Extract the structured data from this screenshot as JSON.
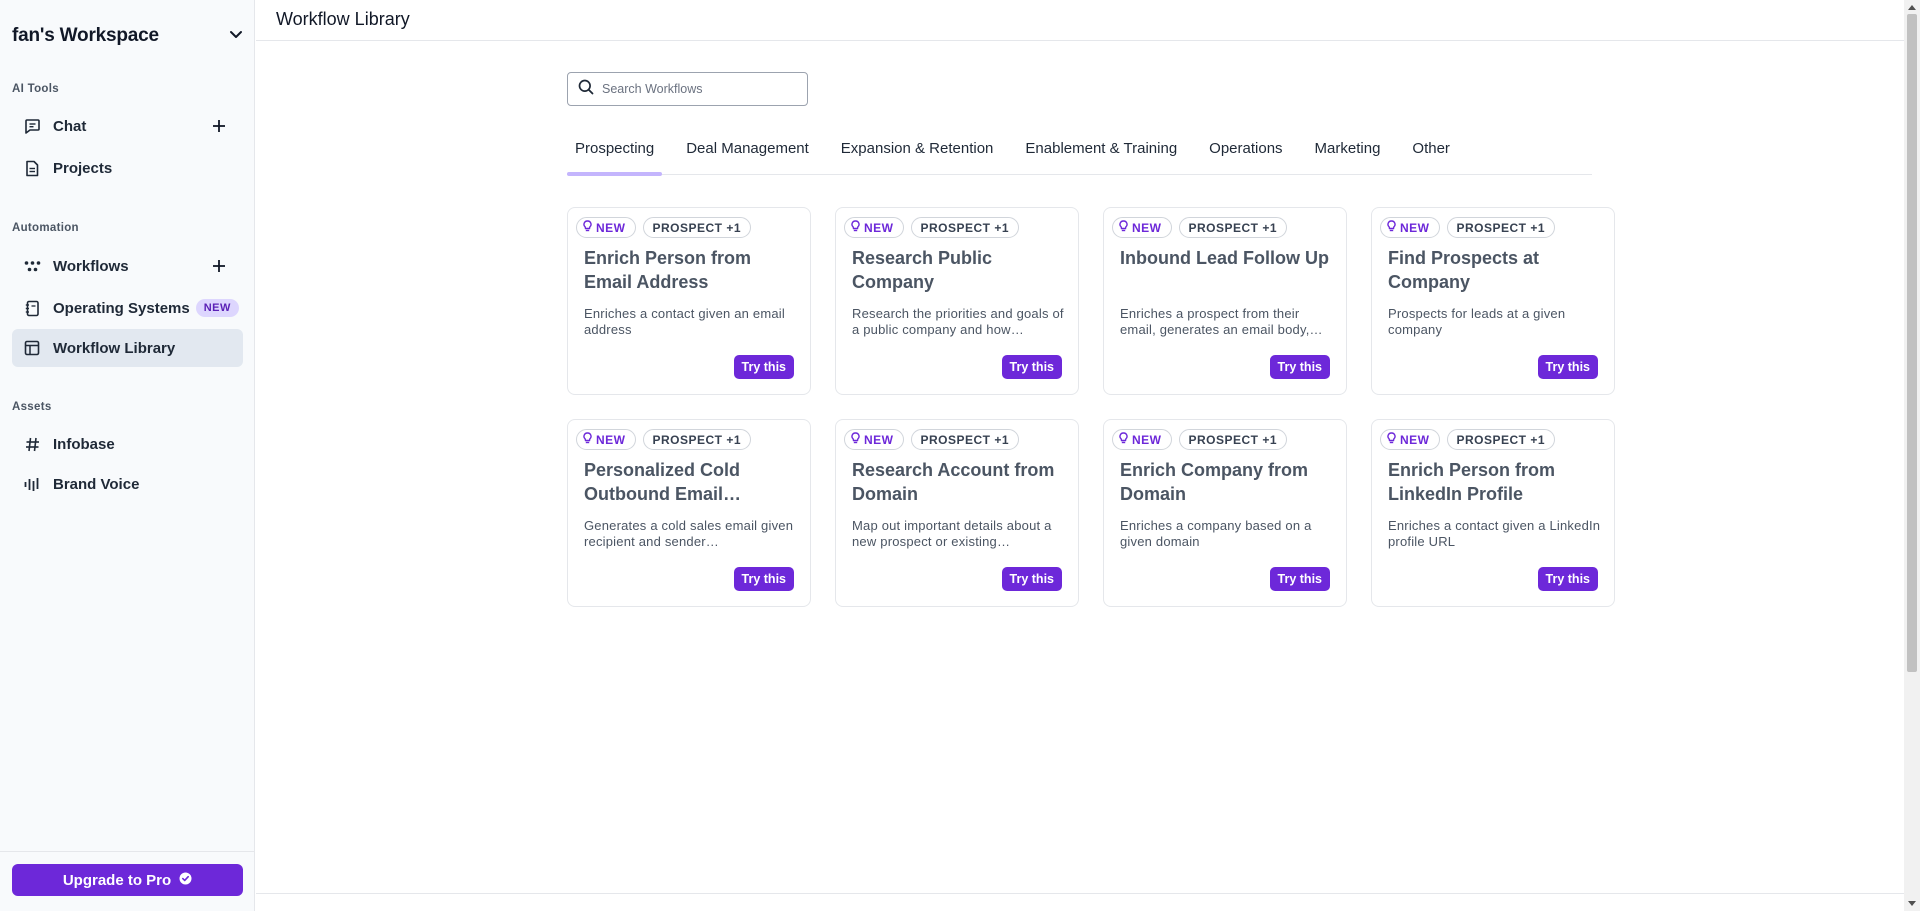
{
  "sidebar": {
    "workspace_name": "fan's Workspace",
    "sections": {
      "ai_tools": "AI Tools",
      "automation": "Automation",
      "assets": "Assets"
    },
    "items": {
      "chat": "Chat",
      "projects": "Projects",
      "workflows": "Workflows",
      "operating_systems": "Operating Systems",
      "operating_systems_badge": "NEW",
      "workflow_library": "Workflow Library",
      "infobase": "Infobase",
      "brand_voice": "Brand Voice"
    },
    "upgrade_label": "Upgrade to Pro",
    "accent_color": "#6d28d9"
  },
  "header": {
    "title": "Workflow Library"
  },
  "search": {
    "placeholder": "Search Workflows",
    "value": ""
  },
  "tabs": [
    {
      "label": "Prospecting",
      "active": true
    },
    {
      "label": "Deal Management",
      "active": false
    },
    {
      "label": "Expansion & Retention",
      "active": false
    },
    {
      "label": "Enablement & Training",
      "active": false
    },
    {
      "label": "Operations",
      "active": false
    },
    {
      "label": "Marketing",
      "active": false
    },
    {
      "label": "Other",
      "active": false
    }
  ],
  "cards": [
    {
      "badge_new": "NEW",
      "badge_tag": "PROSPECT +1",
      "title": "Enrich Person from Email Address",
      "description": "Enriches a contact given an email address",
      "button": "Try this"
    },
    {
      "badge_new": "NEW",
      "badge_tag": "PROSPECT +1",
      "title": "Research Public Company",
      "description": "Research the priorities and goals of a public company and how…",
      "button": "Try this"
    },
    {
      "badge_new": "NEW",
      "badge_tag": "PROSPECT +1",
      "title": "Inbound Lead Follow Up",
      "description": "Enriches a prospect from their email, generates an email body,…",
      "button": "Try this"
    },
    {
      "badge_new": "NEW",
      "badge_tag": "PROSPECT +1",
      "title": "Find Prospects at Company",
      "description": "Prospects for leads at a given company",
      "button": "Try this"
    },
    {
      "badge_new": "NEW",
      "badge_tag": "PROSPECT +1",
      "title": "Personalized Cold Outbound Email…",
      "description": "Generates a cold sales email given recipient and sender…",
      "button": "Try this"
    },
    {
      "badge_new": "NEW",
      "badge_tag": "PROSPECT +1",
      "title": "Research Account from Domain",
      "description": "Map out important details about a new prospect or existing…",
      "button": "Try this"
    },
    {
      "badge_new": "NEW",
      "badge_tag": "PROSPECT +1",
      "title": "Enrich Company from Domain",
      "description": "Enriches a company based on a given domain",
      "button": "Try this"
    },
    {
      "badge_new": "NEW",
      "badge_tag": "PROSPECT +1",
      "title": "Enrich Person from LinkedIn Profile",
      "description": "Enriches a contact given a LinkedIn profile URL",
      "button": "Try this"
    }
  ]
}
